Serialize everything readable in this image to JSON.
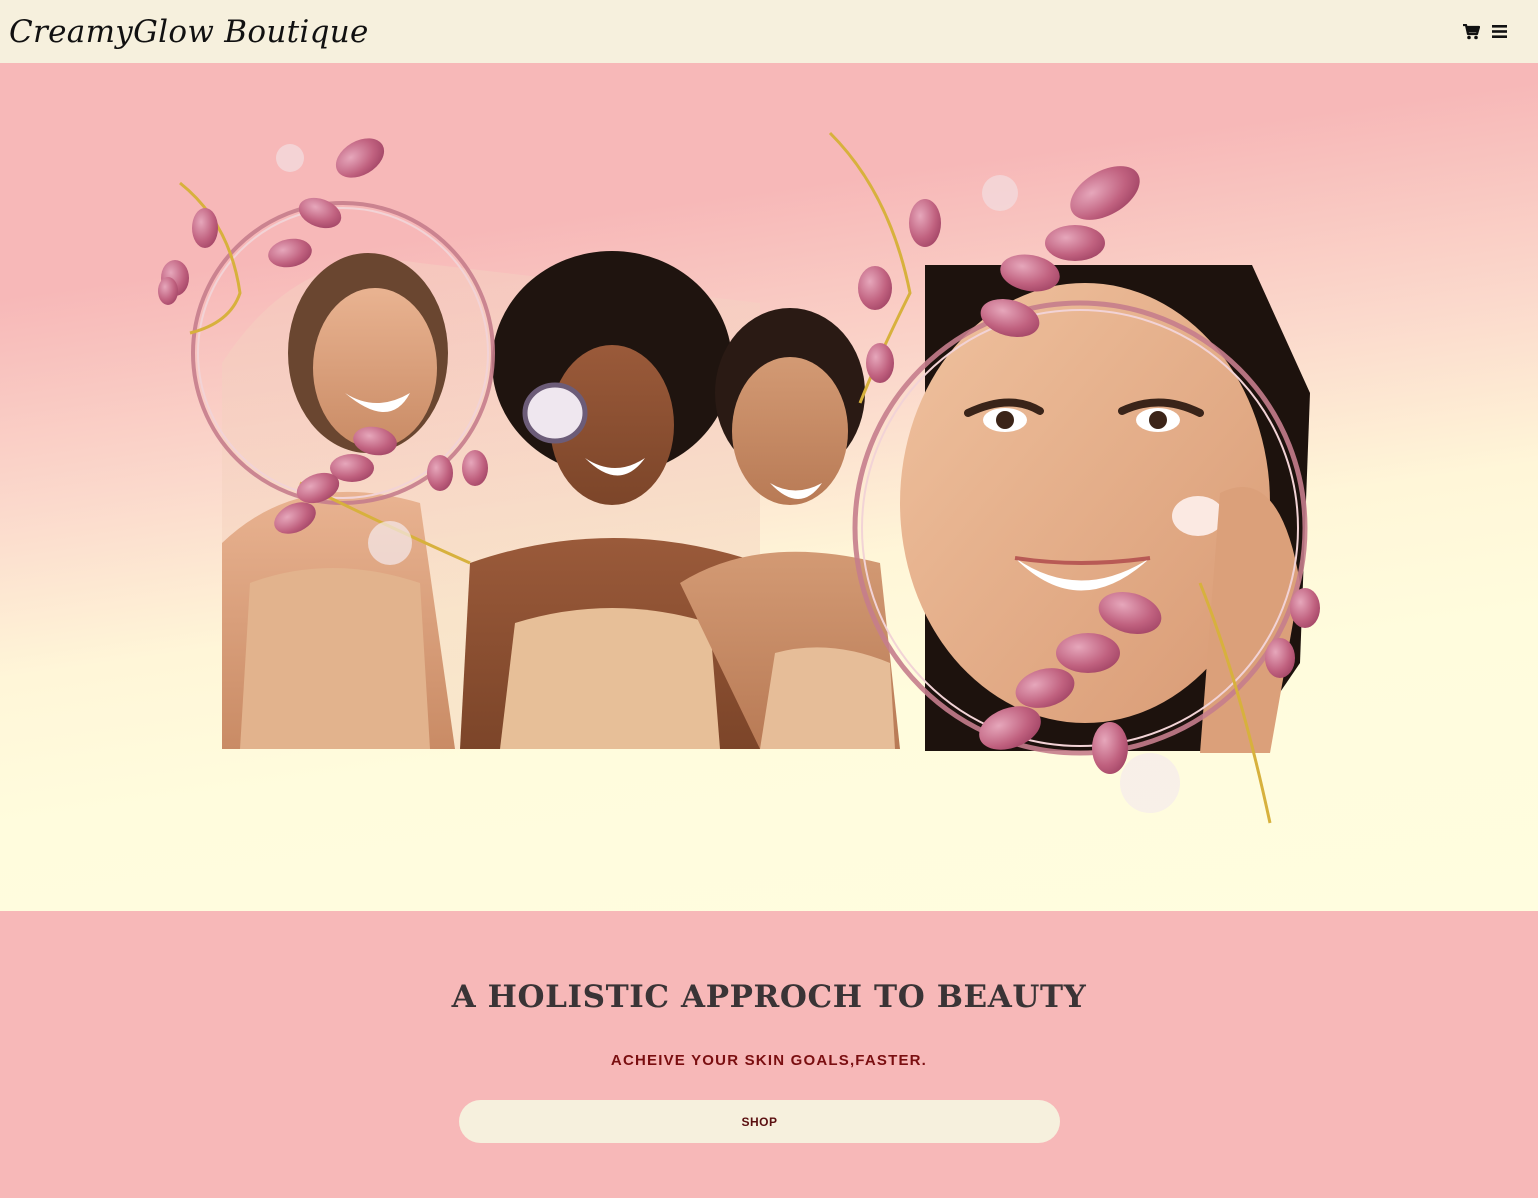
{
  "nav": {
    "brand": "CreamyGlow Boutique",
    "icons": [
      "shopping-cart-icon",
      "hamburger-menu-icon"
    ]
  },
  "hero": {
    "images": [
      "group-of-women-skincare-photo",
      "woman-applying-cream-closeup-photo",
      "floral-wreath-decoration"
    ]
  },
  "promo": {
    "headline": "A HOLISTIC APPROCH TO BEAUTY",
    "subheadline": "ACHEIVE YOUR SKIN GOALS,FASTER.",
    "button_label": "SHOP"
  },
  "colors": {
    "navbar_bg": "#f6f0dd",
    "pink_bg": "#f7b8b8",
    "cream_bg": "#fffcdd",
    "headline_text": "#3a3436",
    "subheadline_text": "#7a0e10",
    "button_bg": "#f6f0dd"
  }
}
